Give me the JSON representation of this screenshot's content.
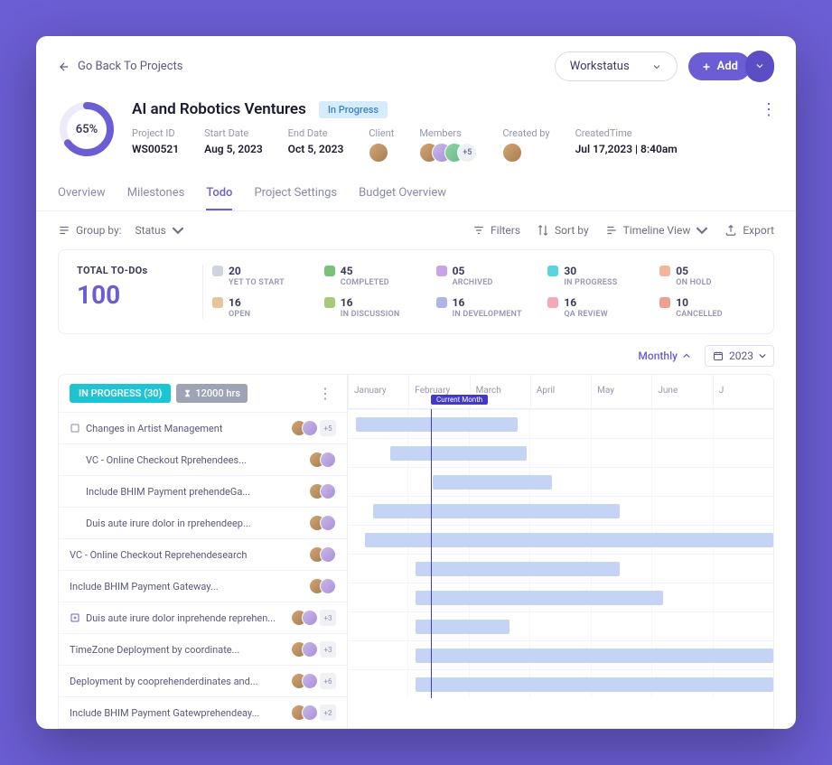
{
  "topbar": {
    "back_label": "Go Back To Projects",
    "workstatus_label": "Workstatus",
    "add_label": "Add"
  },
  "project": {
    "progress_pct": "65%",
    "title": "AI and Robotics Ventures",
    "status_badge": "In Progress",
    "meta": {
      "project_id_label": "Project ID",
      "project_id": "WS00521",
      "start_label": "Start Date",
      "start": "Aug 5, 2023",
      "end_label": "End Date",
      "end": "Oct 5, 2023",
      "client_label": "Client",
      "members_label": "Members",
      "members_more": "+5",
      "created_by_label": "Created by",
      "created_time_label": "CreatedTime",
      "created_time": "Jul 17,2023 | 8:40am"
    }
  },
  "tabs": [
    "Overview",
    "Milestones",
    "Todo",
    "Project Settings",
    "Budget Overview"
  ],
  "active_tab_index": 2,
  "toolbar": {
    "group_by_label": "Group by:",
    "group_by_value": "Status",
    "filters": "Filters",
    "sort": "Sort by",
    "view": "Timeline View",
    "export": "Export"
  },
  "stats": {
    "total_label": "TOTAL TO-DOs",
    "total_value": "100",
    "items": [
      {
        "count": "20",
        "label": "YET TO START",
        "color": "#d0d4dc"
      },
      {
        "count": "45",
        "label": "COMPLETED",
        "color": "#7ac279"
      },
      {
        "count": "05",
        "label": "ARCHIVED",
        "color": "#c9a5e8"
      },
      {
        "count": "30",
        "label": "IN PROGRESS",
        "color": "#5ad4e0"
      },
      {
        "count": "05",
        "label": "ON HOLD",
        "color": "#f5b59a"
      },
      {
        "count": "16",
        "label": "OPEN",
        "color": "#e8c49a"
      },
      {
        "count": "16",
        "label": "IN DISCUSSION",
        "color": "#a8c97a"
      },
      {
        "count": "16",
        "label": "IN DEVELOPMENT",
        "color": "#b0b4e8"
      },
      {
        "count": "16",
        "label": "QA REVIEW",
        "color": "#f5a8b8"
      },
      {
        "count": "10",
        "label": "CANCELLED",
        "color": "#f0a090"
      }
    ]
  },
  "timeline_controls": {
    "monthly": "Monthly",
    "year": "2023"
  },
  "gantt": {
    "group_chip": "IN PROGRESS (30)",
    "hours_chip": "12000 hrs",
    "current_month_label": "Current Month",
    "months": [
      "January",
      "February",
      "March",
      "April",
      "May",
      "June",
      "J"
    ],
    "tasks": [
      {
        "name": "Changes in Artist Management",
        "indent": false,
        "more": "+5",
        "start": 2,
        "span": 38,
        "icon": "box"
      },
      {
        "name": "VC - Online Checkout Rprehendees...",
        "indent": true,
        "more": "",
        "start": 10,
        "span": 32
      },
      {
        "name": "Include BHIM Payment prehendeGa...",
        "indent": true,
        "more": "",
        "start": 20,
        "span": 28
      },
      {
        "name": "Duis aute irure dolor in rprehendeep...",
        "indent": true,
        "more": "",
        "start": 6,
        "span": 58
      },
      {
        "name": "VC - Online Checkout Reprehendesearch",
        "indent": false,
        "more": "",
        "start": 4,
        "span": 96
      },
      {
        "name": "Include BHIM Payment Gateway...",
        "indent": false,
        "more": "",
        "start": 16,
        "span": 48
      },
      {
        "name": "Duis aute irure dolor inprehende reprehen...",
        "indent": false,
        "more": "+3",
        "start": 16,
        "span": 58,
        "icon": "plus"
      },
      {
        "name": "TimeZone Deployment by coordinate...",
        "indent": false,
        "more": "+3",
        "start": 16,
        "span": 22
      },
      {
        "name": "Deployment by cooprehenderdinates and...",
        "indent": false,
        "more": "+6",
        "start": 16,
        "span": 84
      },
      {
        "name": "Include BHIM Payment Gatewprehendeay...",
        "indent": false,
        "more": "+2",
        "start": 16,
        "span": 84
      }
    ]
  }
}
